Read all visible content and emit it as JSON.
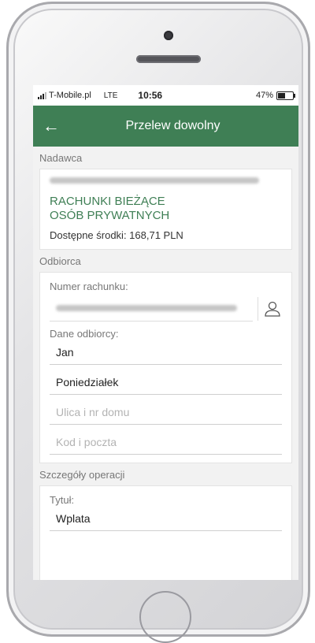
{
  "status": {
    "carrier": "T-Mobile.pl",
    "network": "LTE",
    "time": "10:56",
    "battery": "47%"
  },
  "header": {
    "title": "Przelew dowolny"
  },
  "sender": {
    "section_label": "Nadawca",
    "account_name": "RACHUNKI BIEŻĄCE\nOSÓB PRYWATNYCH",
    "available_funds": "Dostępne środki: 168,71 PLN"
  },
  "recipient": {
    "section_label": "Odbiorca",
    "account_number_label": "Numer rachunku:",
    "recipient_data_label": "Dane odbiorcy:",
    "name_value": "Jan",
    "surname_value": "Poniedziałek",
    "street_placeholder": "Ulica i nr domu",
    "postal_placeholder": "Kod i poczta"
  },
  "details": {
    "section_label": "Szczegóły operacji",
    "title_label": "Tytuł:",
    "title_value": "Wplata"
  },
  "icons": {
    "back": "arrow-left-icon",
    "contacts": "person-icon"
  },
  "colors": {
    "accent": "#3f7f55"
  }
}
